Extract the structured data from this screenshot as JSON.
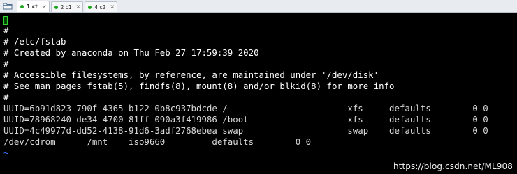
{
  "tabs": [
    {
      "label": "1 ct",
      "dot_color": "#1aa61a",
      "active": true
    },
    {
      "label": "2 c1",
      "dot_color": "#1aa61a",
      "active": false
    },
    {
      "label": "4 c2",
      "dot_color": "#1aa61a",
      "active": false
    }
  ],
  "tab_close_glyph": "×",
  "terminal": {
    "lines": [
      {
        "text": "#",
        "kind": "comment"
      },
      {
        "text": "# /etc/fstab",
        "kind": "comment"
      },
      {
        "text": "# Created by anaconda on Thu Feb 27 17:59:39 2020",
        "kind": "comment"
      },
      {
        "text": "#",
        "kind": "comment"
      },
      {
        "text": "# Accessible filesystems, by reference, are maintained under '/dev/disk'",
        "kind": "comment"
      },
      {
        "text": "# See man pages fstab(5), findfs(8), mount(8) and/or blkid(8) for more info",
        "kind": "comment"
      },
      {
        "text": "#",
        "kind": "comment"
      },
      {
        "text": "UUID=6b91d823-790f-4365-b122-0b8c937bdcde /                       xfs     defaults        0 0",
        "kind": "entry"
      },
      {
        "text": "UUID=78968240-de34-4700-81ff-090a3f419986 /boot                   xfs     defaults        0 0",
        "kind": "entry"
      },
      {
        "text": "UUID=4c49977d-dd52-4138-91d6-3adf2768ebea swap                    swap    defaults        0 0",
        "kind": "entry"
      },
      {
        "text": "/dev/cdrom      /mnt    iso9660         defaults        0 0",
        "kind": "entry"
      },
      {
        "text": "~",
        "kind": "tilde"
      }
    ]
  },
  "watermark": "https://blog.csdn.net/ML908"
}
